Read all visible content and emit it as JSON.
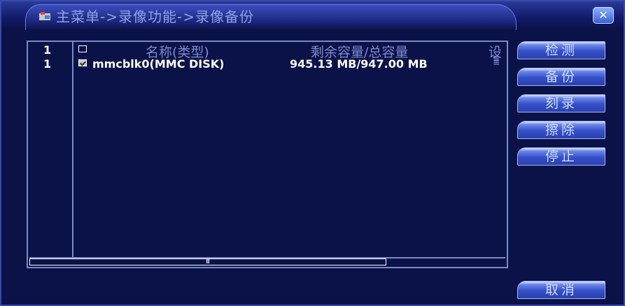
{
  "window": {
    "title": "主菜单->录像功能->录像备份",
    "close_glyph": "✕"
  },
  "list": {
    "header": {
      "num": "1",
      "name": "名称(类型)",
      "capacity": "剩余容量/总容量",
      "setting": "设"
    },
    "rows": [
      {
        "num": "1",
        "checked": true,
        "name": "mmcblk0(MMC DISK)",
        "capacity": "945.13 MB/947.00 MB"
      }
    ],
    "scrollbar": {
      "grip": "III"
    }
  },
  "buttons": {
    "detect": "检测",
    "backup": "备份",
    "burn": "刻录",
    "erase": "擦除",
    "stop": "停止",
    "cancel": "取消"
  },
  "colors": {
    "background": "#0b1248",
    "border": "#7a8ac8",
    "button": "#3550c8",
    "header_text": "#7d8ad0"
  }
}
